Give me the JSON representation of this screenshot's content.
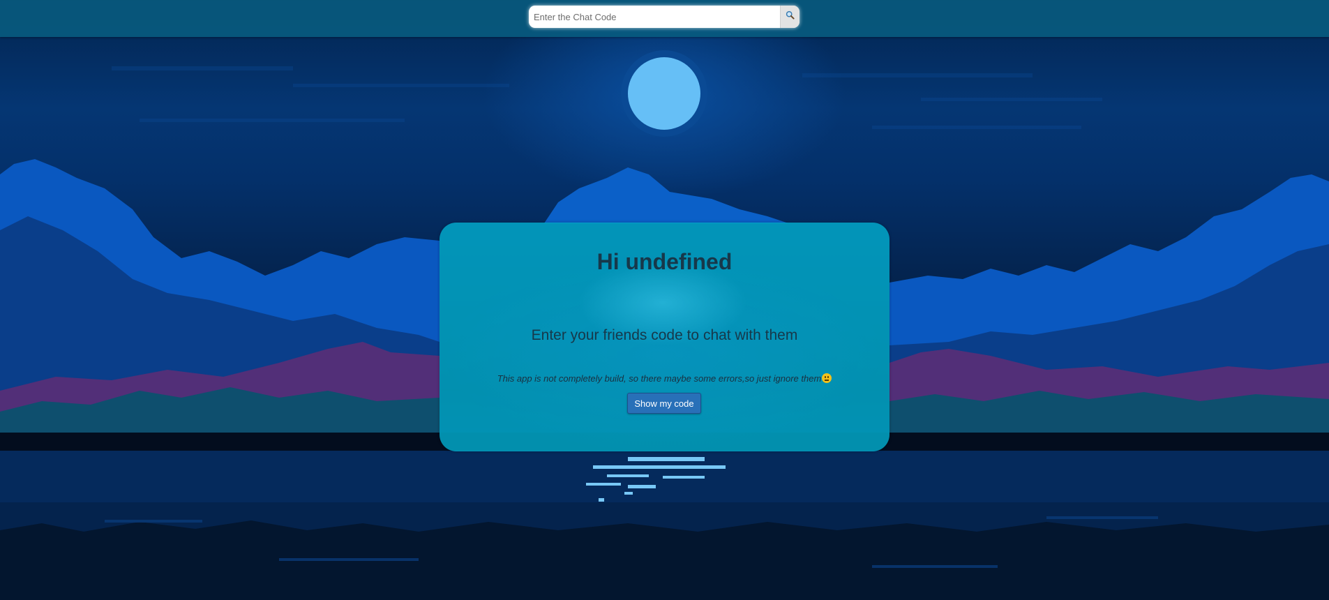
{
  "search": {
    "placeholder": "Enter the Chat Code",
    "value": "",
    "button_icon": "search-icon"
  },
  "card": {
    "greeting": "Hi undefined",
    "subtitle": "Enter your friends code to chat with them",
    "note": "This app is not completely build, so there maybe some errors,so just ignore them",
    "note_emoji": "grimacing-face-icon",
    "show_code_label": "Show my code"
  },
  "colors": {
    "topbar": "#085c80",
    "card": "#02acd0",
    "button": "#2870b8",
    "moon": "#66bff6"
  }
}
